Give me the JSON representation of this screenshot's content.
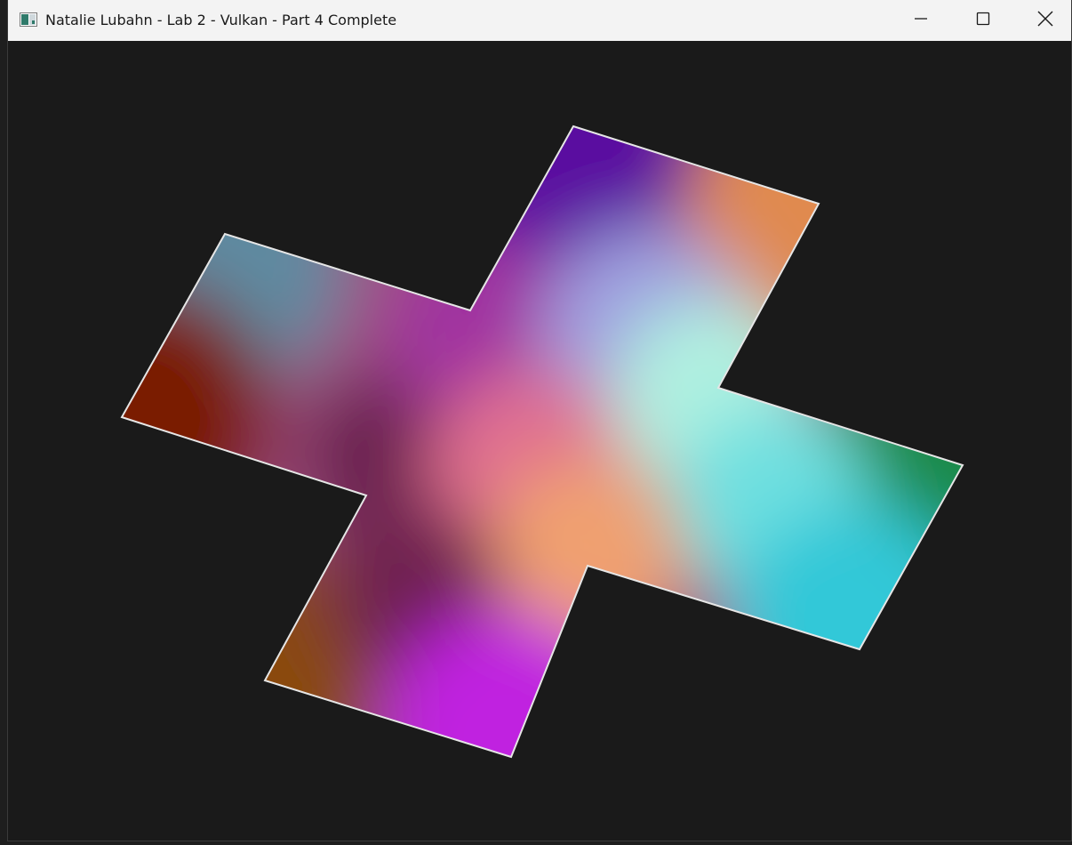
{
  "window": {
    "title": "Natalie Lubahn - Lab 2 - Vulkan - Part 4 Complete",
    "controls": {
      "minimize_icon": "minimize-icon",
      "maximize_icon": "maximize-icon",
      "close_icon": "close-icon"
    }
  },
  "scene": {
    "background_color": "#1a1a1a",
    "outline_color": "#e6e6e6",
    "shape": "cross",
    "vertex_colors": {
      "top_left": "#5f8aa0",
      "top_center": "#5a0fa0",
      "top_right": "#e08a50",
      "left_end": "#7a1e05",
      "center": "#e07090",
      "right_end": "#1f8a4a",
      "bottom_left": "#8a4a0a",
      "bottom_center": "#c020e0",
      "bottom_right": "#30c8d8"
    }
  }
}
